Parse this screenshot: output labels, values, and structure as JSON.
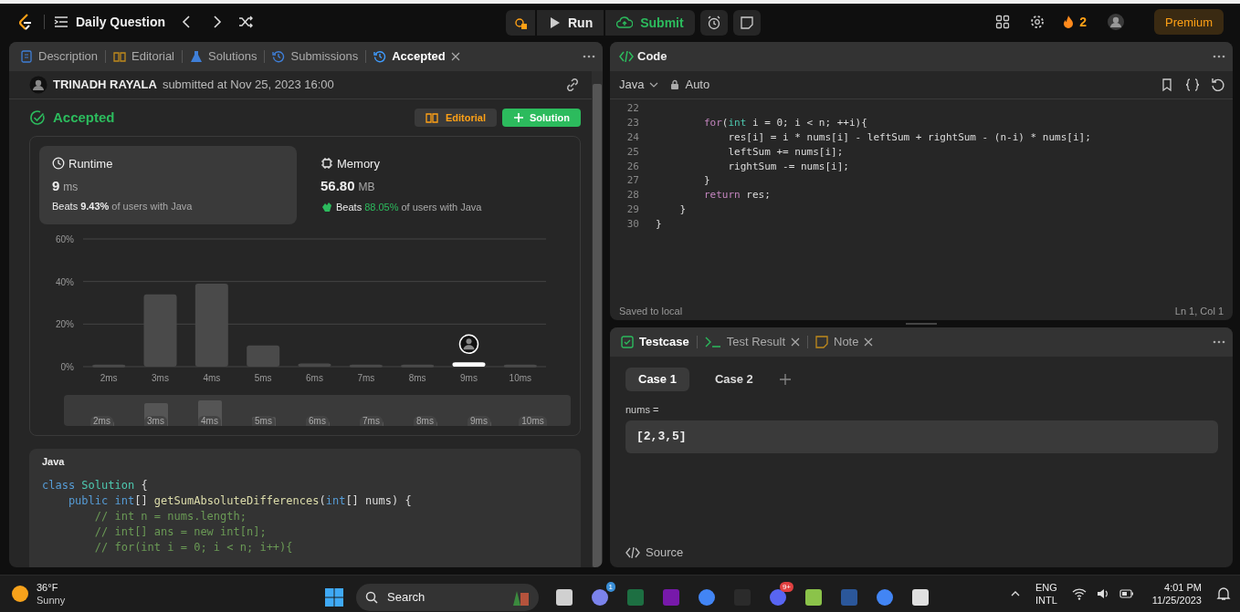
{
  "header": {
    "title": "Daily Question",
    "run": "Run",
    "submit": "Submit",
    "streak": "2",
    "premium": "Premium"
  },
  "left_tabs": [
    {
      "label": "Description",
      "kind": "doc",
      "selected": false,
      "closable": false
    },
    {
      "label": "Editorial",
      "kind": "book",
      "selected": false,
      "closable": false
    },
    {
      "label": "Solutions",
      "kind": "flask",
      "selected": false,
      "closable": false
    },
    {
      "label": "Submissions",
      "kind": "history",
      "selected": false,
      "closable": false
    },
    {
      "label": "Accepted",
      "kind": "history",
      "selected": true,
      "closable": true
    }
  ],
  "submission": {
    "user": "TRINADH RAYALA",
    "info": "submitted at Nov 25, 2023 16:00",
    "status": "Accepted",
    "editorial_button": "Editorial",
    "solution_button": "Solution"
  },
  "stats": [
    {
      "kind": "clock",
      "title": "Runtime",
      "value": "9",
      "unit": "ms",
      "beats": "Beats",
      "percent": "9.43%",
      "suffix": "of users with Java",
      "selected": true,
      "praised": false
    },
    {
      "kind": "chip",
      "title": "Memory",
      "value": "56.80",
      "unit": "MB",
      "beats": "Beats",
      "percent": "88.05%",
      "suffix": "of users with Java",
      "selected": false,
      "praised": true
    }
  ],
  "chart_data": {
    "type": "bar",
    "categories": [
      "2ms",
      "3ms",
      "4ms",
      "5ms",
      "6ms",
      "7ms",
      "8ms",
      "9ms",
      "10ms"
    ],
    "stacked": true,
    "ylim": [
      0,
      60
    ],
    "yticks": [
      {
        "value": 0,
        "label": "0%"
      },
      {
        "value": 20,
        "label": "20%"
      },
      {
        "value": 40,
        "label": "40%"
      },
      {
        "value": 60,
        "label": "60%"
      }
    ],
    "series": [
      {
        "color": "#4a4a4a",
        "values": [
          1,
          34,
          39,
          10,
          1.5,
          1,
          1,
          null,
          1
        ]
      },
      {
        "color": "#ffffff",
        "values": [
          null,
          null,
          null,
          null,
          null,
          null,
          null,
          2,
          null
        ]
      }
    ]
  },
  "overview_labels": [
    "2ms",
    "3ms",
    "4ms",
    "5ms",
    "6ms",
    "7ms",
    "8ms",
    "9ms",
    "10ms"
  ],
  "solution_code": {
    "language": "Java",
    "lines": [
      [
        {
          "kind": "kw",
          "text": "class "
        },
        {
          "kind": "cls",
          "text": "Solution"
        },
        {
          "kind": "plain",
          "text": " {"
        }
      ],
      [
        {
          "kind": "kw",
          "text": "    public int"
        },
        {
          "kind": "plain",
          "text": "[] "
        },
        {
          "kind": "fn",
          "text": "getSumAbsoluteDifferences"
        },
        {
          "kind": "plain",
          "text": "("
        },
        {
          "kind": "kw",
          "text": "int"
        },
        {
          "kind": "plain",
          "text": "[] nums) {"
        }
      ],
      [
        {
          "kind": "comment",
          "text": "        // int n = nums.length;"
        }
      ],
      [
        {
          "kind": "comment",
          "text": "        // int[] ans = new int[n];"
        }
      ],
      [
        {
          "kind": "comment",
          "text": "        // for(int i = 0; i < n; i++){"
        }
      ]
    ]
  },
  "editor": {
    "title": "Code",
    "language": "Java",
    "mode": "Auto",
    "status_left": "Saved to local",
    "status_right": "Ln 1, Col 1",
    "lines": [
      {
        "number": "22"
      },
      {
        "number": "23",
        "tokens": [
          {
            "kind": "ctrl",
            "text": "        for"
          },
          {
            "kind": "plain",
            "text": "("
          },
          {
            "kind": "cls",
            "text": "int"
          },
          {
            "kind": "plain",
            "text": " i = 0; i < n; ++i){"
          }
        ]
      },
      {
        "number": "24",
        "tokens": [
          {
            "kind": "plain",
            "text": "            res[i] = i * nums[i] - leftSum + rightSum - (n-i) * nums[i];"
          }
        ]
      },
      {
        "number": "25",
        "tokens": [
          {
            "kind": "plain",
            "text": "            leftSum += nums[i];"
          }
        ]
      },
      {
        "number": "26",
        "tokens": [
          {
            "kind": "plain",
            "text": "            rightSum -= nums[i];"
          }
        ]
      },
      {
        "number": "27",
        "tokens": [
          {
            "kind": "plain",
            "text": "        }"
          }
        ]
      },
      {
        "number": "28",
        "tokens": [
          {
            "kind": "ctrl",
            "text": "        return"
          },
          {
            "kind": "plain",
            "text": " res;"
          }
        ]
      },
      {
        "number": "29",
        "tokens": [
          {
            "kind": "plain",
            "text": "    }"
          }
        ]
      },
      {
        "number": "30",
        "tokens": [
          {
            "kind": "plain",
            "text": "}"
          }
        ]
      }
    ]
  },
  "bottom_tabs": [
    {
      "label": "Testcase",
      "kind": "check",
      "selected": true,
      "closable": false
    },
    {
      "label": "Test Result",
      "kind": "terminal",
      "selected": false,
      "closable": true
    },
    {
      "label": "Note",
      "kind": "note",
      "selected": false,
      "closable": true
    }
  ],
  "cases": [
    {
      "label": "Case 1",
      "selected": true
    },
    {
      "label": "Case 2",
      "selected": false
    }
  ],
  "param": {
    "label": "nums =",
    "value": "[2,3,5]"
  },
  "source": "Source",
  "taskbar": {
    "temp": "36°F",
    "condition": "Sunny",
    "search": "Search",
    "apps": [
      {
        "kind": "taskview"
      },
      {
        "kind": "chat",
        "badge": "1"
      },
      {
        "kind": "excel"
      },
      {
        "kind": "onenote"
      },
      {
        "kind": "chrome"
      },
      {
        "kind": "terminal"
      },
      {
        "kind": "discord",
        "badge": "9+"
      },
      {
        "kind": "notepad"
      },
      {
        "kind": "word"
      },
      {
        "kind": "chrome"
      },
      {
        "kind": "snip"
      }
    ],
    "lang1": "ENG",
    "lang2": "INTL",
    "time": "4:01 PM",
    "date": "11/25/2023"
  }
}
